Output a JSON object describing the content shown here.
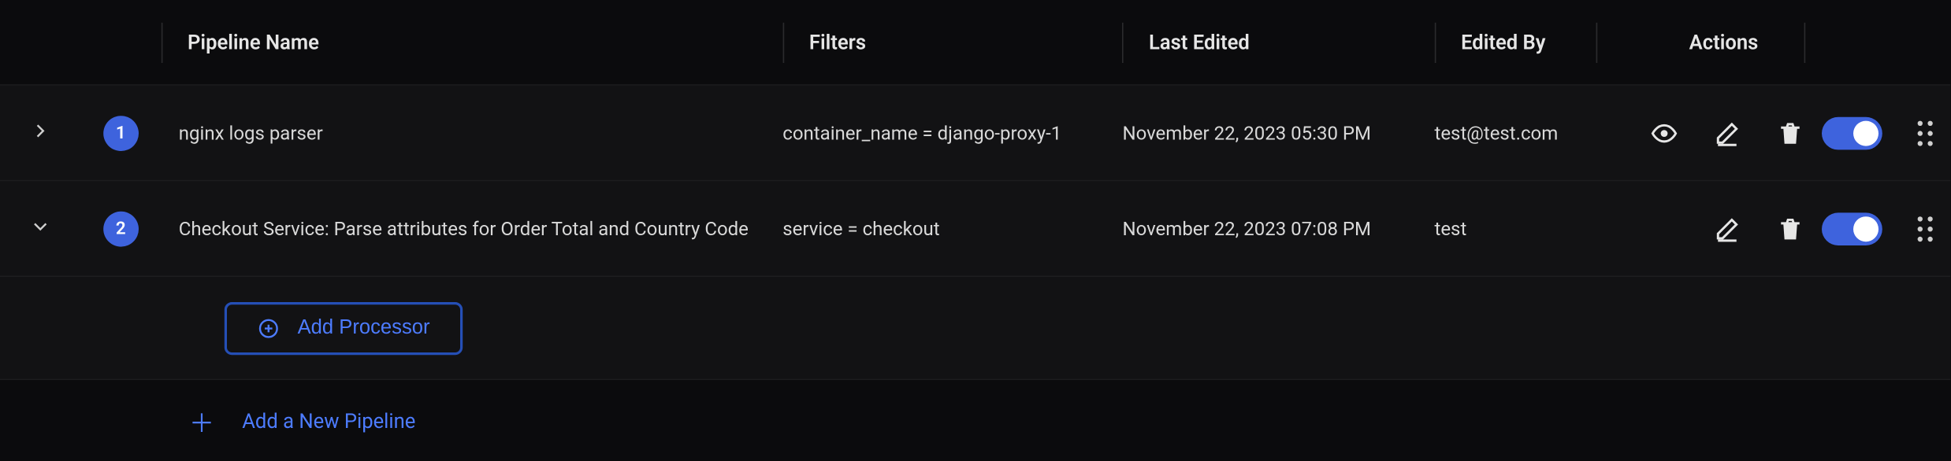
{
  "columns": {
    "name": "Pipeline Name",
    "filters": "Filters",
    "lastEdited": "Last Edited",
    "editedBy": "Edited By",
    "actions": "Actions"
  },
  "rows": [
    {
      "index": "1",
      "expanded": false,
      "name": "nginx logs parser",
      "filter": "container_name = django-proxy-1",
      "lastEdited": "November 22, 2023 05:30 PM",
      "editedBy": "test@test.com",
      "hasEye": true
    },
    {
      "index": "2",
      "expanded": true,
      "name": "Checkout Service: Parse attributes for Order Total and Country Code",
      "filter": "service = checkout",
      "lastEdited": "November 22, 2023 07:08 PM",
      "editedBy": "test",
      "hasEye": false
    }
  ],
  "addProcessor": "Add Processor",
  "addPipeline": "Add a New Pipeline"
}
